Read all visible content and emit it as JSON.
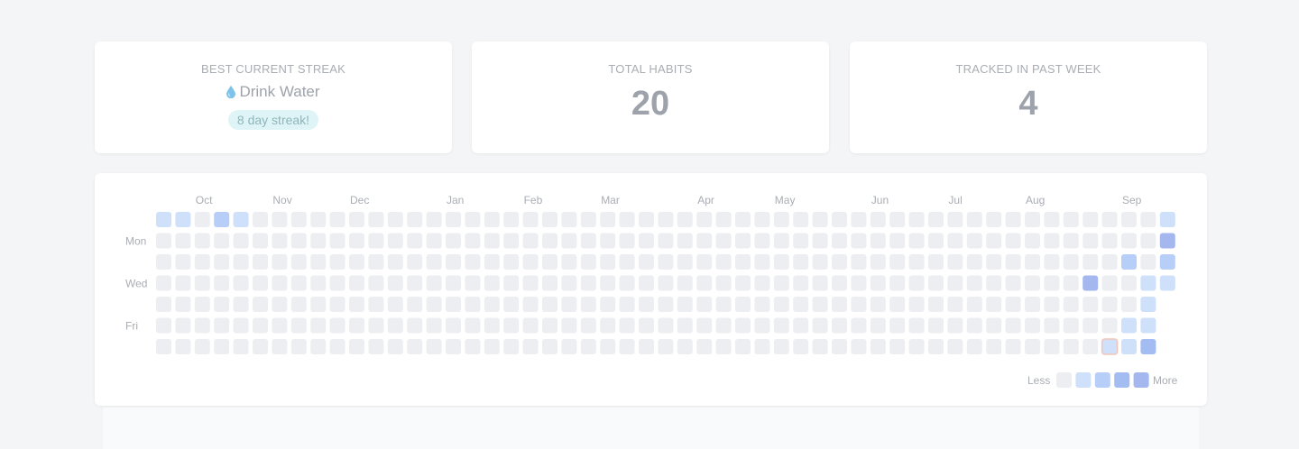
{
  "stats": {
    "best_streak": {
      "label": "BEST CURRENT STREAK",
      "habit": "Drink Water",
      "icon": "water-drop-icon",
      "badge": "8 day streak!"
    },
    "total_habits": {
      "label": "TOTAL HABITS",
      "value": "20"
    },
    "tracked_week": {
      "label": "TRACKED IN PAST WEEK",
      "value": "4"
    }
  },
  "heatmap": {
    "months": [
      {
        "label": "Oct",
        "col": 2
      },
      {
        "label": "Nov",
        "col": 6
      },
      {
        "label": "Dec",
        "col": 10
      },
      {
        "label": "Jan",
        "col": 15
      },
      {
        "label": "Feb",
        "col": 19
      },
      {
        "label": "Mar",
        "col": 23
      },
      {
        "label": "Apr",
        "col": 28
      },
      {
        "label": "May",
        "col": 32
      },
      {
        "label": "Jun",
        "col": 37
      },
      {
        "label": "Jul",
        "col": 41
      },
      {
        "label": "Aug",
        "col": 45
      },
      {
        "label": "Sep",
        "col": 50
      }
    ],
    "day_labels": [
      {
        "label": "Mon",
        "row": 1
      },
      {
        "label": "Wed",
        "row": 3
      },
      {
        "label": "Fri",
        "row": 5
      }
    ],
    "weeks": 53,
    "levels": [
      "#eceef1",
      "#cfe0fb",
      "#b7cef8",
      "#a3bcf2",
      "#a4b7ee"
    ],
    "highlight_color": "#f3c5b7",
    "active_cells": [
      {
        "col": 0,
        "row": 0,
        "level": 1
      },
      {
        "col": 1,
        "row": 0,
        "level": 1
      },
      {
        "col": 3,
        "row": 0,
        "level": 2
      },
      {
        "col": 4,
        "row": 0,
        "level": 1
      },
      {
        "col": 48,
        "row": 3,
        "level": 4
      },
      {
        "col": 49,
        "row": 6,
        "level": 1,
        "highlight": true
      },
      {
        "col": 50,
        "row": 2,
        "level": 2
      },
      {
        "col": 50,
        "row": 5,
        "level": 1
      },
      {
        "col": 50,
        "row": 6,
        "level": 1
      },
      {
        "col": 51,
        "row": 3,
        "level": 1
      },
      {
        "col": 51,
        "row": 4,
        "level": 1
      },
      {
        "col": 51,
        "row": 5,
        "level": 1
      },
      {
        "col": 51,
        "row": 6,
        "level": 3
      },
      {
        "col": 52,
        "row": 0,
        "level": 1
      },
      {
        "col": 52,
        "row": 1,
        "level": 4
      },
      {
        "col": 52,
        "row": 2,
        "level": 2
      },
      {
        "col": 52,
        "row": 3,
        "level": 1
      }
    ],
    "empty_cells": [
      {
        "col": 52,
        "row": 4
      },
      {
        "col": 52,
        "row": 5
      },
      {
        "col": 52,
        "row": 6
      }
    ],
    "legend": {
      "less": "Less",
      "more": "More"
    }
  }
}
